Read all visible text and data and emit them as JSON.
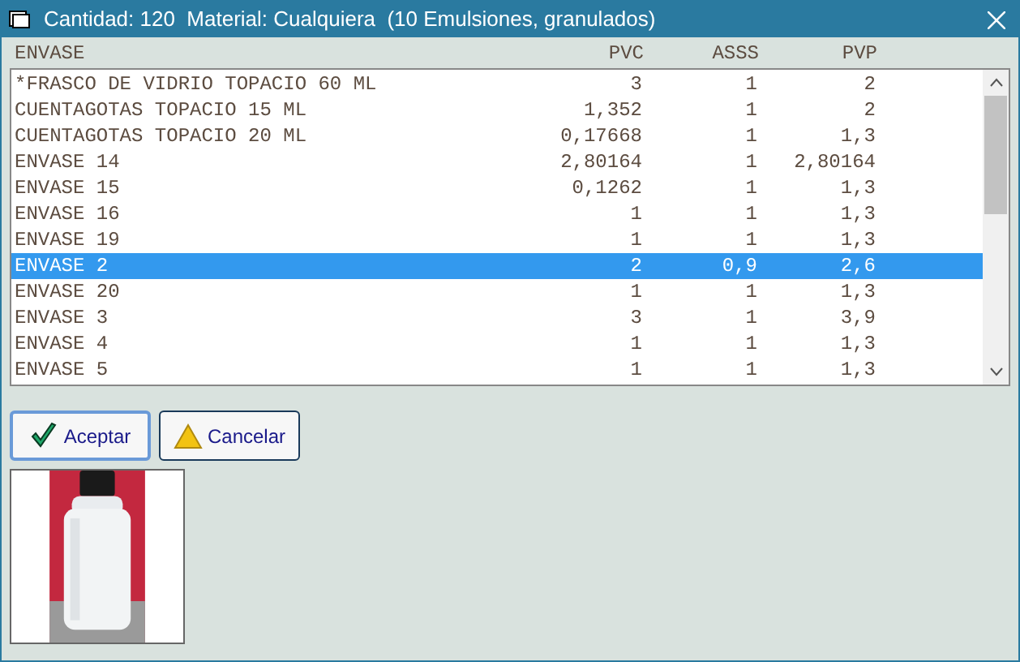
{
  "window": {
    "title": "Cantidad: 120  Material: Cualquiera  (10 Emulsiones, granulados)"
  },
  "table": {
    "columns": [
      "ENVASE",
      "PVC",
      "ASSS",
      "PVP"
    ],
    "rows": [
      {
        "cells": [
          "*FRASCO DE VIDRIO TOPACIO 60 ML",
          "3",
          "1",
          "2"
        ],
        "selected": false
      },
      {
        "cells": [
          "CUENTAGOTAS TOPACIO 15 ML",
          "1,352",
          "1",
          "2"
        ],
        "selected": false
      },
      {
        "cells": [
          "CUENTAGOTAS TOPACIO 20 ML",
          "0,17668",
          "1",
          "1,3"
        ],
        "selected": false
      },
      {
        "cells": [
          "ENVASE 14",
          "2,80164",
          "1",
          "2,80164"
        ],
        "selected": false
      },
      {
        "cells": [
          "ENVASE 15",
          "0,1262",
          "1",
          "1,3"
        ],
        "selected": false
      },
      {
        "cells": [
          "ENVASE 16",
          "1",
          "1",
          "1,3"
        ],
        "selected": false
      },
      {
        "cells": [
          "ENVASE 19",
          "1",
          "1",
          "1,3"
        ],
        "selected": false
      },
      {
        "cells": [
          "ENVASE 2",
          "2",
          "0,9",
          "2,6"
        ],
        "selected": true
      },
      {
        "cells": [
          "ENVASE 20",
          "1",
          "1",
          "1,3"
        ],
        "selected": false
      },
      {
        "cells": [
          "ENVASE 3",
          "3",
          "1",
          "3,9"
        ],
        "selected": false
      },
      {
        "cells": [
          "ENVASE 4",
          "1",
          "1",
          "1,3"
        ],
        "selected": false
      },
      {
        "cells": [
          "ENVASE 5",
          "1",
          "1",
          "1,3"
        ],
        "selected": false
      }
    ]
  },
  "buttons": [
    {
      "label": "Aceptar",
      "kind": "ok"
    },
    {
      "label": "Cancelar",
      "kind": "cancel"
    }
  ]
}
